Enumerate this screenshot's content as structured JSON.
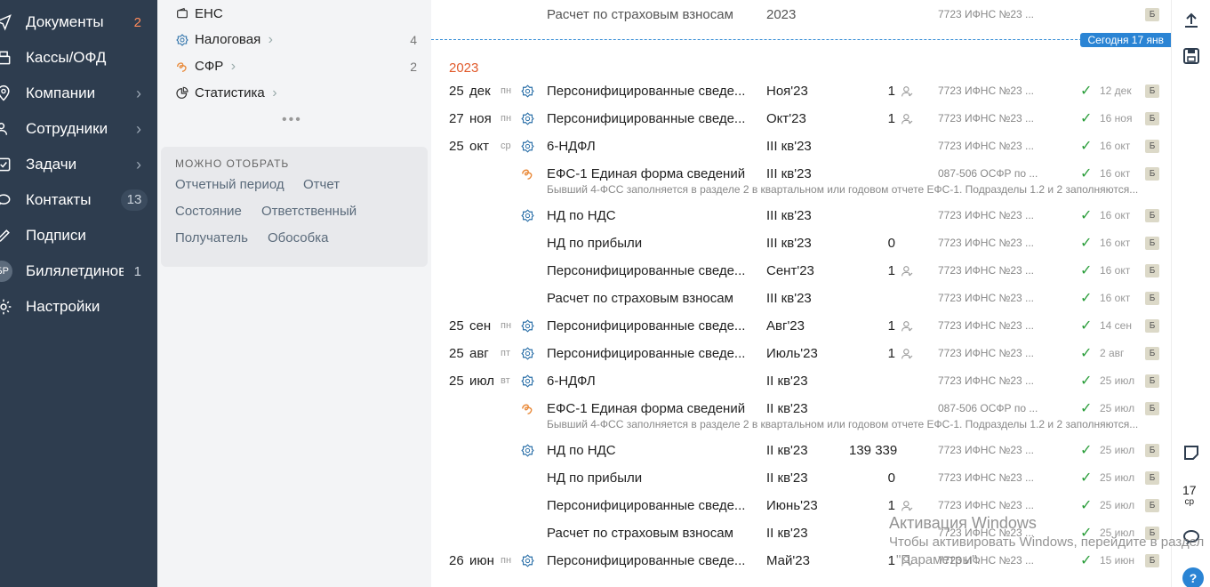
{
  "nav": [
    {
      "label": "Документы",
      "count": "2",
      "hot": true,
      "icon": "paper-plane-icon"
    },
    {
      "label": "Кассы/ОФД",
      "icon": "cash-register-icon"
    },
    {
      "label": "Компании",
      "chev": true,
      "icon": "location-pin-icon"
    },
    {
      "label": "Сотрудники",
      "chev": true,
      "icon": "users-icon"
    },
    {
      "label": "Задачи",
      "chev": true,
      "icon": "checkbox-icon"
    },
    {
      "label": "Контакты",
      "bubble": "13",
      "icon": "chat-icon"
    },
    {
      "label": "Подписи",
      "icon": "pen-icon"
    },
    {
      "label": "Билялетдинов",
      "count": "1",
      "avatar": "БР",
      "icon": "avatar"
    },
    {
      "label": "Настройки",
      "icon": "gear-icon"
    }
  ],
  "mid": {
    "items": [
      {
        "label": "ЕНС",
        "icon": "wallet-icon"
      },
      {
        "label": "Налоговая",
        "chev": true,
        "count": "4",
        "icon": "tax-emblem-icon"
      },
      {
        "label": "СФР",
        "chev": true,
        "count": "2",
        "icon": "sfr-logo-icon"
      },
      {
        "label": "Статистика",
        "chev": true,
        "icon": "pie-chart-icon"
      }
    ],
    "more": "•••",
    "filter_title": "МОЖНО ОТОБРАТЬ",
    "filters": [
      "Отчетный период",
      "Отчет",
      "Состояние",
      "Ответственный",
      "Получатель",
      "Обособка"
    ]
  },
  "main": {
    "today_badge": "Сегодня 17 янв",
    "year": "2023",
    "top_row": {
      "name": "Расчет по страховым взносам",
      "period": "2023",
      "org": "7723 ИФНС №23 ...",
      "badge": "Б"
    },
    "rows": [
      {
        "day": "25",
        "mon": "дек",
        "dow": "пн",
        "icon": "tax",
        "name": "Персонифицированные сведе...",
        "period": "Ноя'23",
        "num": "1",
        "person": true,
        "org": "7723 ИФНС №23 ...",
        "date": "12 дек",
        "badge": "Б"
      },
      {
        "day": "27",
        "mon": "ноя",
        "dow": "пн",
        "icon": "tax",
        "name": "Персонифицированные сведе...",
        "period": "Окт'23",
        "num": "1",
        "person": true,
        "org": "7723 ИФНС №23 ...",
        "date": "16 ноя",
        "badge": "Б"
      },
      {
        "day": "25",
        "mon": "окт",
        "dow": "ср",
        "icon": "tax",
        "name": "6-НДФЛ",
        "period": "III кв'23",
        "num": "",
        "org": "7723 ИФНС №23 ...",
        "date": "16 окт",
        "badge": "Б"
      },
      {
        "icon": "sfr",
        "name": "ЕФС-1 Единая форма сведений",
        "period": "III кв'23",
        "num": "",
        "org": "087-506 ОСФР по ...",
        "date": "16 окт",
        "badge": "Б",
        "note": "Бывший 4-ФСС заполняется в разделе 2 в квартальном или годовом отчете ЕФС-1. Подразделы 1.2 и 2 заполняются..."
      },
      {
        "icon": "tax",
        "name": "НД по НДС",
        "period": "III кв'23",
        "num": "",
        "org": "7723 ИФНС №23 ...",
        "date": "16 окт",
        "badge": "Б"
      },
      {
        "name": "НД по прибыли",
        "period": "III кв'23",
        "num": "0",
        "org": "7723 ИФНС №23 ...",
        "date": "16 окт",
        "badge": "Б"
      },
      {
        "name": "Персонифицированные сведе...",
        "period": "Сент'23",
        "num": "1",
        "person": true,
        "org": "7723 ИФНС №23 ...",
        "date": "16 окт",
        "badge": "Б"
      },
      {
        "name": "Расчет по страховым взносам",
        "period": "III кв'23",
        "num": "",
        "org": "7723 ИФНС №23 ...",
        "date": "16 окт",
        "badge": "Б"
      },
      {
        "day": "25",
        "mon": "сен",
        "dow": "пн",
        "icon": "tax",
        "name": "Персонифицированные сведе...",
        "period": "Авг'23",
        "num": "1",
        "person": true,
        "org": "7723 ИФНС №23 ...",
        "date": "14 сен",
        "badge": "Б"
      },
      {
        "day": "25",
        "mon": "авг",
        "dow": "пт",
        "icon": "tax",
        "name": "Персонифицированные сведе...",
        "period": "Июль'23",
        "num": "1",
        "person": true,
        "org": "7723 ИФНС №23 ...",
        "date": "2 авг",
        "badge": "Б"
      },
      {
        "day": "25",
        "mon": "июл",
        "dow": "вт",
        "icon": "tax",
        "name": "6-НДФЛ",
        "period": "II кв'23",
        "num": "",
        "org": "7723 ИФНС №23 ...",
        "date": "25 июл",
        "badge": "Б"
      },
      {
        "icon": "sfr",
        "name": "ЕФС-1 Единая форма сведений",
        "period": "II кв'23",
        "num": "",
        "org": "087-506 ОСФР по ...",
        "date": "25 июл",
        "badge": "Б",
        "note": "Бывший 4-ФСС заполняется в разделе 2 в квартальном или годовом отчете ЕФС-1. Подразделы 1.2 и 2 заполняются..."
      },
      {
        "icon": "tax",
        "name": "НД по НДС",
        "period": "II кв'23",
        "num": "139 339",
        "org": "7723 ИФНС №23 ...",
        "date": "25 июл",
        "badge": "Б"
      },
      {
        "name": "НД по прибыли",
        "period": "II кв'23",
        "num": "0",
        "org": "7723 ИФНС №23 ...",
        "date": "25 июл",
        "badge": "Б"
      },
      {
        "name": "Персонифицированные сведе...",
        "period": "Июнь'23",
        "num": "1",
        "person": true,
        "org": "7723 ИФНС №23 ...",
        "date": "25 июл",
        "badge": "Б"
      },
      {
        "name": "Расчет по страховым взносам",
        "period": "II кв'23",
        "num": "",
        "org": "7723 ИФНС №23 ...",
        "date": "25 июл",
        "badge": "Б"
      },
      {
        "day": "26",
        "mon": "июн",
        "dow": "пн",
        "icon": "tax",
        "name": "Персонифицированные сведе...",
        "period": "Май'23",
        "num": "1",
        "person": true,
        "org": "7723 ИФНС №23 ...",
        "date": "15 июн",
        "badge": "Б"
      }
    ]
  },
  "right": {
    "cal_day": "17",
    "cal_dow": "ср",
    "help": "?"
  },
  "watermark": {
    "line1": "Активация Windows",
    "line2": "Чтобы активировать Windows, перейдите в раздел",
    "line3": "\"Параметры\"."
  }
}
